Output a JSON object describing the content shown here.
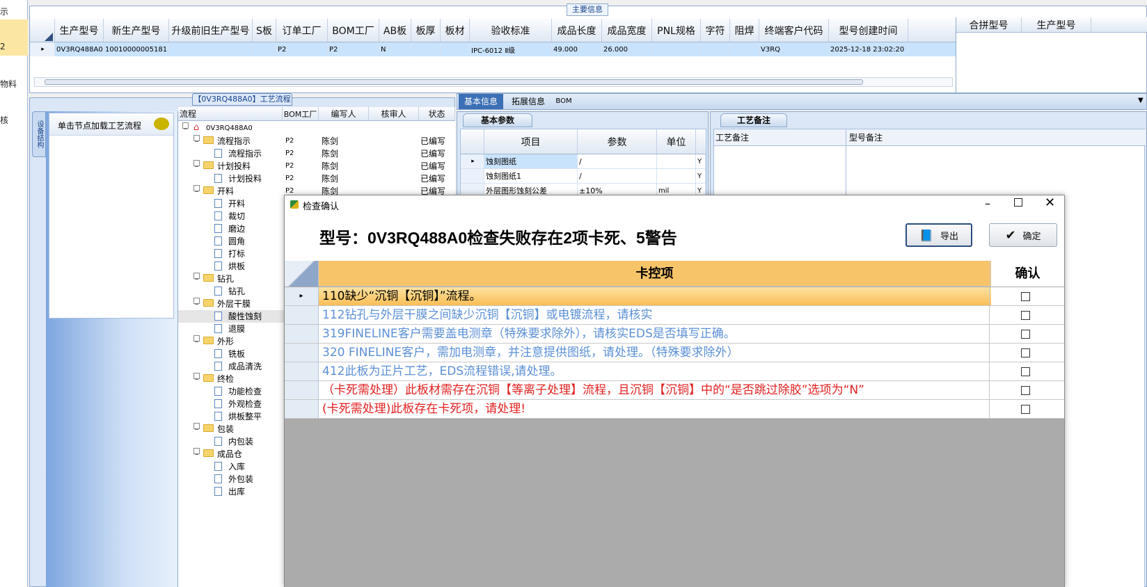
{
  "left_strip": {
    "items": [
      "示",
      "2",
      "物料",
      "核"
    ]
  },
  "main_info": {
    "title": "主要信息",
    "columns": [
      "生产型号",
      "新生产型号",
      "升级前旧生产型号",
      "S板",
      "订单工厂",
      "BOM工厂",
      "AB板",
      "板厚",
      "板材",
      "验收标准",
      "成品长度",
      "成品宽度",
      "PNL规格",
      "字符",
      "阻焊",
      "终端客户代码",
      "型号创建时间"
    ],
    "row": [
      "0V3RQ488A0",
      "10010000005181",
      "",
      "",
      "P2",
      "P2",
      "N",
      "",
      "",
      "IPC-6012 Ⅱ级",
      "49.000",
      "26.000",
      "",
      "",
      "",
      "V3RQ",
      "2025-12-18 23:02:20"
    ],
    "side_columns": [
      "合拼型号",
      "生产型号"
    ]
  },
  "process": {
    "title": "【0V3RQ488A0】工艺流程",
    "side_tab": "设备结构",
    "hint": "单击节点加载工艺流程",
    "columns": [
      "流程",
      "BOM工厂",
      "编写人",
      "核审人",
      "状态"
    ],
    "root": "0V3RQ488A0",
    "rows": [
      {
        "label": "流程指示",
        "level": 1,
        "bom": "P2",
        "writer": "陈剑",
        "status": "已编写"
      },
      {
        "label": "流程指示",
        "level": 2,
        "bom": "P2",
        "writer": "陈剑",
        "status": "已编写"
      },
      {
        "label": "计划投料",
        "level": 1,
        "bom": "P2",
        "writer": "陈剑",
        "status": "已编写"
      },
      {
        "label": "计划投料",
        "level": 2,
        "bom": "P2",
        "writer": "陈剑",
        "status": "已编写"
      },
      {
        "label": "开料",
        "level": 1,
        "bom": "P2",
        "writer": "陈剑",
        "status": "已编写"
      },
      {
        "label": "开料",
        "level": 2,
        "bom": "",
        "writer": "",
        "status": ""
      },
      {
        "label": "裁切",
        "level": 2,
        "bom": "",
        "writer": "",
        "status": ""
      },
      {
        "label": "磨边",
        "level": 2,
        "bom": "",
        "writer": "",
        "status": ""
      },
      {
        "label": "圆角",
        "level": 2,
        "bom": "",
        "writer": "",
        "status": ""
      },
      {
        "label": "打标",
        "level": 2,
        "bom": "",
        "writer": "",
        "status": ""
      },
      {
        "label": "烘板",
        "level": 2,
        "bom": "",
        "writer": "",
        "status": ""
      },
      {
        "label": "钻孔",
        "level": 1,
        "bom": "",
        "writer": "",
        "status": ""
      },
      {
        "label": "钻孔",
        "level": 2,
        "bom": "",
        "writer": "",
        "status": ""
      },
      {
        "label": "外层干膜",
        "level": 1,
        "bom": "",
        "writer": "",
        "status": ""
      },
      {
        "label": "酸性蚀刻",
        "level": 2,
        "bom": "",
        "writer": "",
        "status": ""
      },
      {
        "label": "退膜",
        "level": 2,
        "bom": "",
        "writer": "",
        "status": ""
      },
      {
        "label": "外形",
        "level": 1,
        "bom": "",
        "writer": "",
        "status": ""
      },
      {
        "label": "铣板",
        "level": 2,
        "bom": "",
        "writer": "",
        "status": ""
      },
      {
        "label": "成品清洗",
        "level": 2,
        "bom": "",
        "writer": "",
        "status": ""
      },
      {
        "label": "终检",
        "level": 1,
        "bom": "",
        "writer": "",
        "status": ""
      },
      {
        "label": "功能检查",
        "level": 2,
        "bom": "",
        "writer": "",
        "status": ""
      },
      {
        "label": "外观检查",
        "level": 2,
        "bom": "",
        "writer": "",
        "status": ""
      },
      {
        "label": "烘板整平",
        "level": 2,
        "bom": "",
        "writer": "",
        "status": ""
      },
      {
        "label": "包装",
        "level": 1,
        "bom": "",
        "writer": "",
        "status": ""
      },
      {
        "label": "内包装",
        "level": 2,
        "bom": "",
        "writer": "",
        "status": ""
      },
      {
        "label": "成品仓",
        "level": 1,
        "bom": "",
        "writer": "",
        "status": ""
      },
      {
        "label": "入库",
        "level": 2,
        "bom": "",
        "writer": "",
        "status": ""
      },
      {
        "label": "外包装",
        "level": 2,
        "bom": "",
        "writer": "",
        "status": ""
      },
      {
        "label": "出库",
        "level": 2,
        "bom": "",
        "writer": "",
        "status": ""
      }
    ]
  },
  "right_tabs": [
    "基本信息",
    "拓展信息",
    "BOM"
  ],
  "basic_params": {
    "tab": "基本参数",
    "columns": [
      "项目",
      "参数",
      "单位"
    ],
    "rows": [
      [
        "蚀刻图纸",
        "/",
        "",
        "Y"
      ],
      [
        "蚀刻图纸1",
        "/",
        "",
        "Y"
      ],
      [
        "外层图形蚀刻公差",
        "±10%",
        "mil",
        "Y"
      ]
    ]
  },
  "process_notes": {
    "tab": "工艺备注",
    "columns": [
      "工艺备注",
      "型号备注"
    ]
  },
  "dialog": {
    "title": "检查确认",
    "heading": "型号：0V3RQ488A0检查失败存在2项卡死、5警告",
    "export_label": "导出",
    "ok_label": "确定",
    "col_item": "卡控项",
    "col_confirm": "确认",
    "rows": [
      {
        "text": "110缺少“沉铜【沉铜】”流程。",
        "color": "#000000",
        "selected": true
      },
      {
        "text": "112钻孔与外层干膜之间缺少沉铜【沉铜】或电镀流程，请核实",
        "color": "#5b8fd6",
        "selected": false
      },
      {
        "text": "319FINELINE客户需要盖电测章（特殊要求除外），请核实EDS是否填写正确。",
        "color": "#5b8fd6",
        "selected": false
      },
      {
        "text": "320 FINELINE客户，需加电测章，并注意提供图纸，请处理。（特殊要求除外）",
        "color": "#5b8fd6",
        "selected": false
      },
      {
        "text": "412此板为正片工艺，EDS流程错误,请处理。",
        "color": "#5b8fd6",
        "selected": false
      },
      {
        "text": "（卡死需处理）此板材需存在沉铜【等离子处理】流程，且沉铜【沉铜】中的“是否跳过除胶”选项为“N”",
        "color": "#e02020",
        "selected": false
      },
      {
        "text": "(卡死需处理)此板存在卡死项，请处理!",
        "color": "#e02020",
        "selected": false
      }
    ]
  }
}
